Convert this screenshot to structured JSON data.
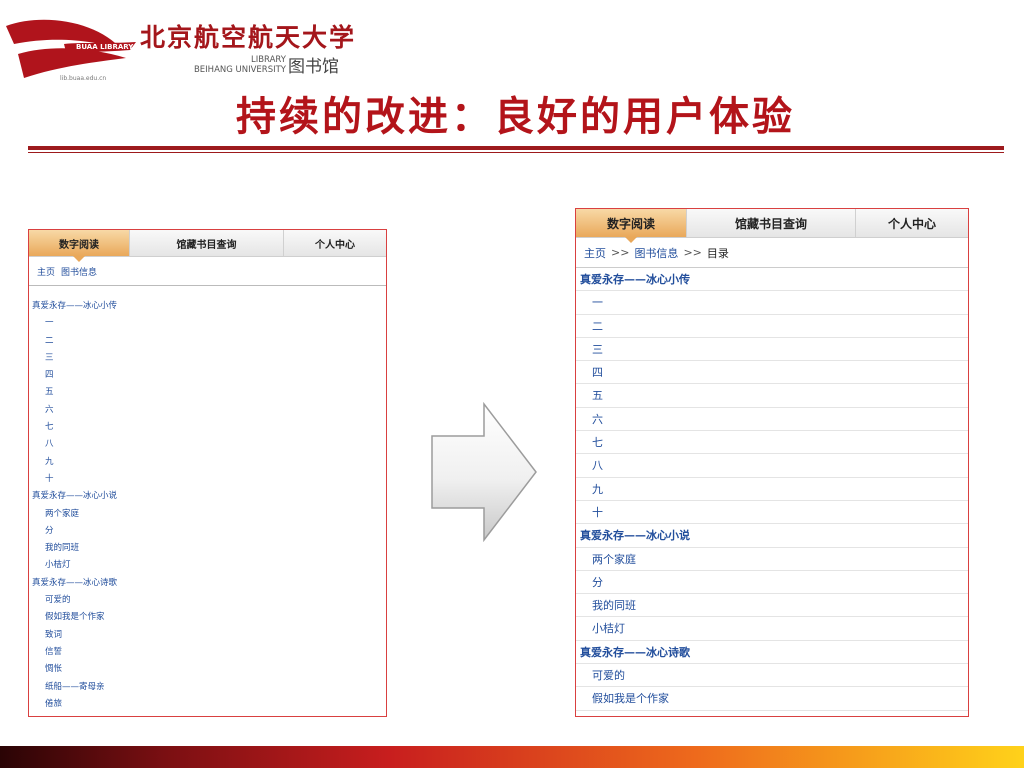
{
  "header": {
    "university_cn": "北京航空航天大学",
    "library_en_line1": "LIBRARY",
    "library_en_line2": "BEIHANG UNIVERSITY",
    "library_cn": "图书馆",
    "logo_text": "BUAA LIBRARY",
    "logo_url": "lib.buaa.edu.cn",
    "brand_color": "#a4161b"
  },
  "slide": {
    "title": "持续的改进：良好的用户体验"
  },
  "before_panel": {
    "tabs": [
      "数字阅读",
      "馆藏书目查询",
      "个人中心"
    ],
    "active_tab": 0,
    "breadcrumb": {
      "home": "主页",
      "section": "图书信息"
    },
    "toc": [
      {
        "text": "真爱永存——冰心小传",
        "kind": "section"
      },
      {
        "text": "一",
        "kind": "chapter"
      },
      {
        "text": "二",
        "kind": "chapter"
      },
      {
        "text": "三",
        "kind": "chapter"
      },
      {
        "text": "四",
        "kind": "chapter"
      },
      {
        "text": "五",
        "kind": "chapter"
      },
      {
        "text": "六",
        "kind": "chapter"
      },
      {
        "text": "七",
        "kind": "chapter"
      },
      {
        "text": "八",
        "kind": "chapter"
      },
      {
        "text": "九",
        "kind": "chapter"
      },
      {
        "text": "十",
        "kind": "chapter"
      },
      {
        "text": "真爱永存——冰心小说",
        "kind": "section"
      },
      {
        "text": "两个家庭",
        "kind": "chapter"
      },
      {
        "text": "分",
        "kind": "chapter"
      },
      {
        "text": "我的同班",
        "kind": "chapter"
      },
      {
        "text": "小桔灯",
        "kind": "chapter"
      },
      {
        "text": "真爱永存——冰心诗歌",
        "kind": "section"
      },
      {
        "text": "可爱的",
        "kind": "chapter"
      },
      {
        "text": "假如我是个作家",
        "kind": "chapter"
      },
      {
        "text": "致词",
        "kind": "chapter"
      },
      {
        "text": "信誓",
        "kind": "chapter"
      },
      {
        "text": "惆怅",
        "kind": "chapter"
      },
      {
        "text": "纸船——寄母亲",
        "kind": "chapter"
      },
      {
        "text": "倦旅",
        "kind": "chapter"
      }
    ]
  },
  "after_panel": {
    "tabs": [
      "数字阅读",
      "馆藏书目查询",
      "个人中心"
    ],
    "active_tab": 0,
    "breadcrumb": {
      "home": "主页",
      "sep": ">>",
      "section": "图书信息",
      "current": "目录"
    },
    "toc": [
      {
        "text": "真爱永存——冰心小传",
        "kind": "section"
      },
      {
        "text": "一",
        "kind": "chapter"
      },
      {
        "text": "二",
        "kind": "chapter"
      },
      {
        "text": "三",
        "kind": "chapter"
      },
      {
        "text": "四",
        "kind": "chapter"
      },
      {
        "text": "五",
        "kind": "chapter"
      },
      {
        "text": "六",
        "kind": "chapter"
      },
      {
        "text": "七",
        "kind": "chapter"
      },
      {
        "text": "八",
        "kind": "chapter"
      },
      {
        "text": "九",
        "kind": "chapter"
      },
      {
        "text": "十",
        "kind": "chapter"
      },
      {
        "text": "真爱永存——冰心小说",
        "kind": "section"
      },
      {
        "text": "两个家庭",
        "kind": "chapter"
      },
      {
        "text": "分",
        "kind": "chapter"
      },
      {
        "text": "我的同班",
        "kind": "chapter"
      },
      {
        "text": "小桔灯",
        "kind": "chapter"
      },
      {
        "text": "真爱永存——冰心诗歌",
        "kind": "section"
      },
      {
        "text": "可爱的",
        "kind": "chapter"
      },
      {
        "text": "假如我是个作家",
        "kind": "chapter"
      }
    ]
  },
  "icons": {
    "logo": "buaa-library-logo",
    "arrow": "right-arrow-icon"
  },
  "colors": {
    "accent": "#b3141a",
    "link": "#224e9c",
    "active_tab": "#e9a85a",
    "panel_border": "#d94040"
  }
}
